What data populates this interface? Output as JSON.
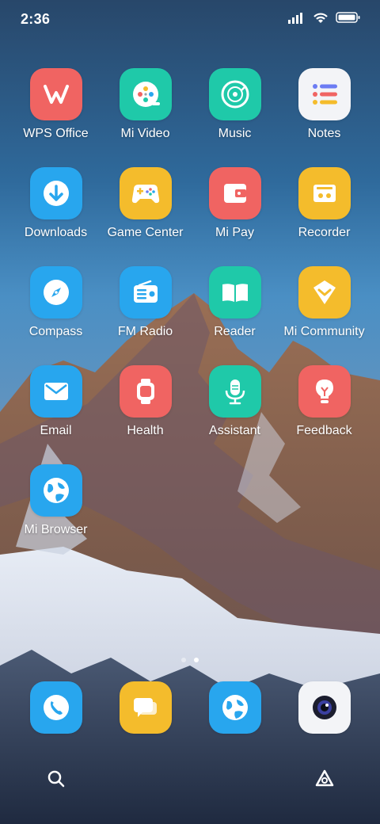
{
  "status_bar": {
    "time": "2:36"
  },
  "apps": [
    {
      "label": "WPS Office",
      "icon": "wps-office-icon",
      "color": "#f06462"
    },
    {
      "label": "Mi Video",
      "icon": "mi-video-icon",
      "color": "#1fc9a9"
    },
    {
      "label": "Music",
      "icon": "music-icon",
      "color": "#1fc9a9"
    },
    {
      "label": "Notes",
      "icon": "notes-icon",
      "color": "#f3f4f7"
    },
    {
      "label": "Downloads",
      "icon": "downloads-icon",
      "color": "#28a6ee"
    },
    {
      "label": "Game Center",
      "icon": "game-center-icon",
      "color": "#f4bc2c"
    },
    {
      "label": "Mi Pay",
      "icon": "mi-pay-icon",
      "color": "#f06462"
    },
    {
      "label": "Recorder",
      "icon": "recorder-icon",
      "color": "#f4bc2c"
    },
    {
      "label": "Compass",
      "icon": "compass-icon",
      "color": "#28a6ee"
    },
    {
      "label": "FM Radio",
      "icon": "fm-radio-icon",
      "color": "#28a6ee"
    },
    {
      "label": "Reader",
      "icon": "reader-icon",
      "color": "#1fc9a9"
    },
    {
      "label": "Mi Community",
      "icon": "mi-community-icon",
      "color": "#f4bc2c"
    },
    {
      "label": "Email",
      "icon": "email-icon",
      "color": "#28a6ee"
    },
    {
      "label": "Health",
      "icon": "health-icon",
      "color": "#f06462"
    },
    {
      "label": "Assistant",
      "icon": "assistant-icon",
      "color": "#1fc9a9"
    },
    {
      "label": "Feedback",
      "icon": "feedback-icon",
      "color": "#f06462"
    },
    {
      "label": "Mi Browser",
      "icon": "mi-browser-icon",
      "color": "#28a6ee"
    }
  ],
  "dock": [
    {
      "icon": "phone-icon",
      "color": "#28a6ee"
    },
    {
      "icon": "messages-icon",
      "color": "#f4bc2c"
    },
    {
      "icon": "browser-icon",
      "color": "#28a6ee"
    },
    {
      "icon": "camera-icon",
      "color": "#f3f4f7"
    }
  ],
  "pager": {
    "pages": 2,
    "active": 2
  }
}
